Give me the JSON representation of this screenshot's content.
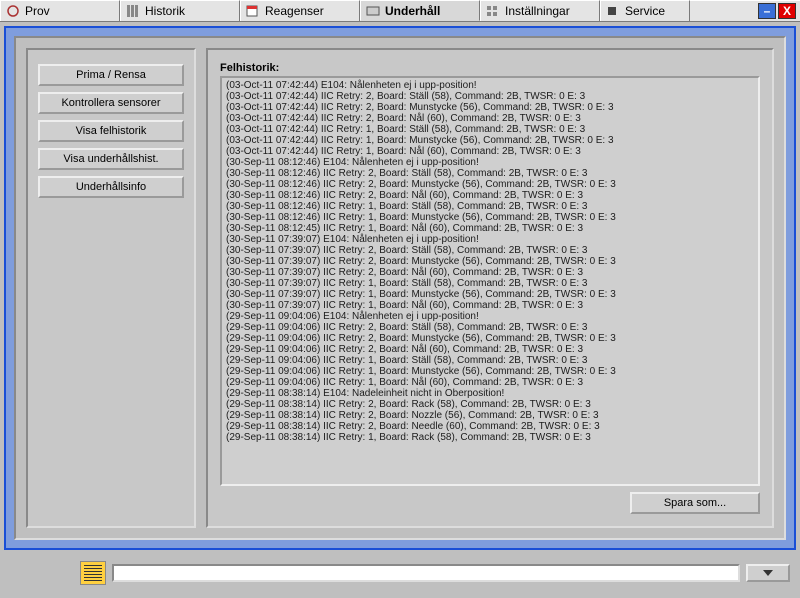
{
  "tabs": {
    "prov": "Prov",
    "historik": "Historik",
    "reagenser": "Reagenser",
    "underhall": "Underhåll",
    "installningar": "Inställningar",
    "service": "Service"
  },
  "side_buttons": {
    "prima_rensa": "Prima / Rensa",
    "kontrollera_sensorer": "Kontrollera sensorer",
    "visa_felhistorik": "Visa felhistorik",
    "visa_underhallshist": "Visa underhållshist.",
    "underhallsinfo": "Underhållsinfo"
  },
  "main": {
    "heading": "Felhistorik:",
    "save_button": "Spara som..."
  },
  "log": [
    "(03-Oct-11 07:42:44) E104: Nålenheten ej i upp-position!",
    "(03-Oct-11 07:42:44) IIC Retry: 2, Board: Ställ (58), Command: 2B, TWSR: 0 E: 3",
    "(03-Oct-11 07:42:44) IIC Retry: 2, Board: Munstycke (56), Command: 2B, TWSR: 0 E: 3",
    "(03-Oct-11 07:42:44) IIC Retry: 2, Board: Nål (60), Command: 2B, TWSR: 0 E: 3",
    "(03-Oct-11 07:42:44) IIC Retry: 1, Board: Ställ (58), Command: 2B, TWSR: 0 E: 3",
    "(03-Oct-11 07:42:44) IIC Retry: 1, Board: Munstycke (56), Command: 2B, TWSR: 0 E: 3",
    "(03-Oct-11 07:42:44) IIC Retry: 1, Board: Nål (60), Command: 2B, TWSR: 0 E: 3",
    "(30-Sep-11 08:12:46) E104: Nålenheten ej i upp-position!",
    "(30-Sep-11 08:12:46) IIC Retry: 2, Board: Ställ (58), Command: 2B, TWSR: 0 E: 3",
    "(30-Sep-11 08:12:46) IIC Retry: 2, Board: Munstycke (56), Command: 2B, TWSR: 0 E: 3",
    "(30-Sep-11 08:12:46) IIC Retry: 2, Board: Nål (60), Command: 2B, TWSR: 0 E: 3",
    "(30-Sep-11 08:12:46) IIC Retry: 1, Board: Ställ (58), Command: 2B, TWSR: 0 E: 3",
    "(30-Sep-11 08:12:46) IIC Retry: 1, Board: Munstycke (56), Command: 2B, TWSR: 0 E: 3",
    "(30-Sep-11 08:12:45) IIC Retry: 1, Board: Nål (60), Command: 2B, TWSR: 0 E: 3",
    "(30-Sep-11 07:39:07) E104: Nålenheten ej i upp-position!",
    "(30-Sep-11 07:39:07) IIC Retry: 2, Board: Ställ (58), Command: 2B, TWSR: 0 E: 3",
    "(30-Sep-11 07:39:07) IIC Retry: 2, Board: Munstycke (56), Command: 2B, TWSR: 0 E: 3",
    "(30-Sep-11 07:39:07) IIC Retry: 2, Board: Nål (60), Command: 2B, TWSR: 0 E: 3",
    "(30-Sep-11 07:39:07) IIC Retry: 1, Board: Ställ (58), Command: 2B, TWSR: 0 E: 3",
    "(30-Sep-11 07:39:07) IIC Retry: 1, Board: Munstycke (56), Command: 2B, TWSR: 0 E: 3",
    "(30-Sep-11 07:39:07) IIC Retry: 1, Board: Nål (60), Command: 2B, TWSR: 0 E: 3",
    "(29-Sep-11 09:04:06) E104: Nålenheten ej i upp-position!",
    "(29-Sep-11 09:04:06) IIC Retry: 2, Board: Ställ (58), Command: 2B, TWSR: 0 E: 3",
    "(29-Sep-11 09:04:06) IIC Retry: 2, Board: Munstycke (56), Command: 2B, TWSR: 0 E: 3",
    "(29-Sep-11 09:04:06) IIC Retry: 2, Board: Nål (60), Command: 2B, TWSR: 0 E: 3",
    "(29-Sep-11 09:04:06) IIC Retry: 1, Board: Ställ (58), Command: 2B, TWSR: 0 E: 3",
    "(29-Sep-11 09:04:06) IIC Retry: 1, Board: Munstycke (56), Command: 2B, TWSR: 0 E: 3",
    "(29-Sep-11 09:04:06) IIC Retry: 1, Board: Nål (60), Command: 2B, TWSR: 0 E: 3",
    "(29-Sep-11 08:38:14) E104: Nadeleinheit nicht in Oberposition!",
    "(29-Sep-11 08:38:14) IIC Retry: 2, Board: Rack (58), Command: 2B, TWSR: 0 E: 3",
    "(29-Sep-11 08:38:14) IIC Retry: 2, Board: Nozzle (56), Command: 2B, TWSR: 0 E: 3",
    "(29-Sep-11 08:38:14) IIC Retry: 2, Board: Needle (60), Command: 2B, TWSR: 0 E: 3",
    "(29-Sep-11 08:38:14) IIC Retry: 1, Board: Rack (58), Command: 2B, TWSR: 0 E: 3"
  ],
  "statusbar": {
    "text": ""
  }
}
